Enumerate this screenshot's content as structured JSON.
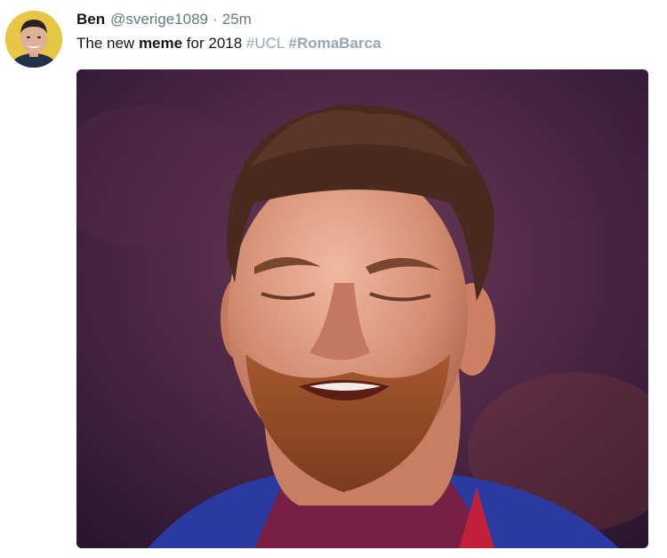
{
  "tweet": {
    "display_name": "Ben",
    "handle": "@sverige1089",
    "separator": "·",
    "timestamp": "25m",
    "text_prefix": "The new ",
    "text_bold": "meme",
    "text_middle": " for 2018 ",
    "hashtag_1": "#UCL",
    "hashtag_2": "#RomaBarca",
    "avatar_icon": "user-avatar-photo",
    "media_icon": "photo-man-squinting-face"
  },
  "colors": {
    "name": "#14171a",
    "secondary": "#657786",
    "hashtag": "#9aa6b1"
  }
}
